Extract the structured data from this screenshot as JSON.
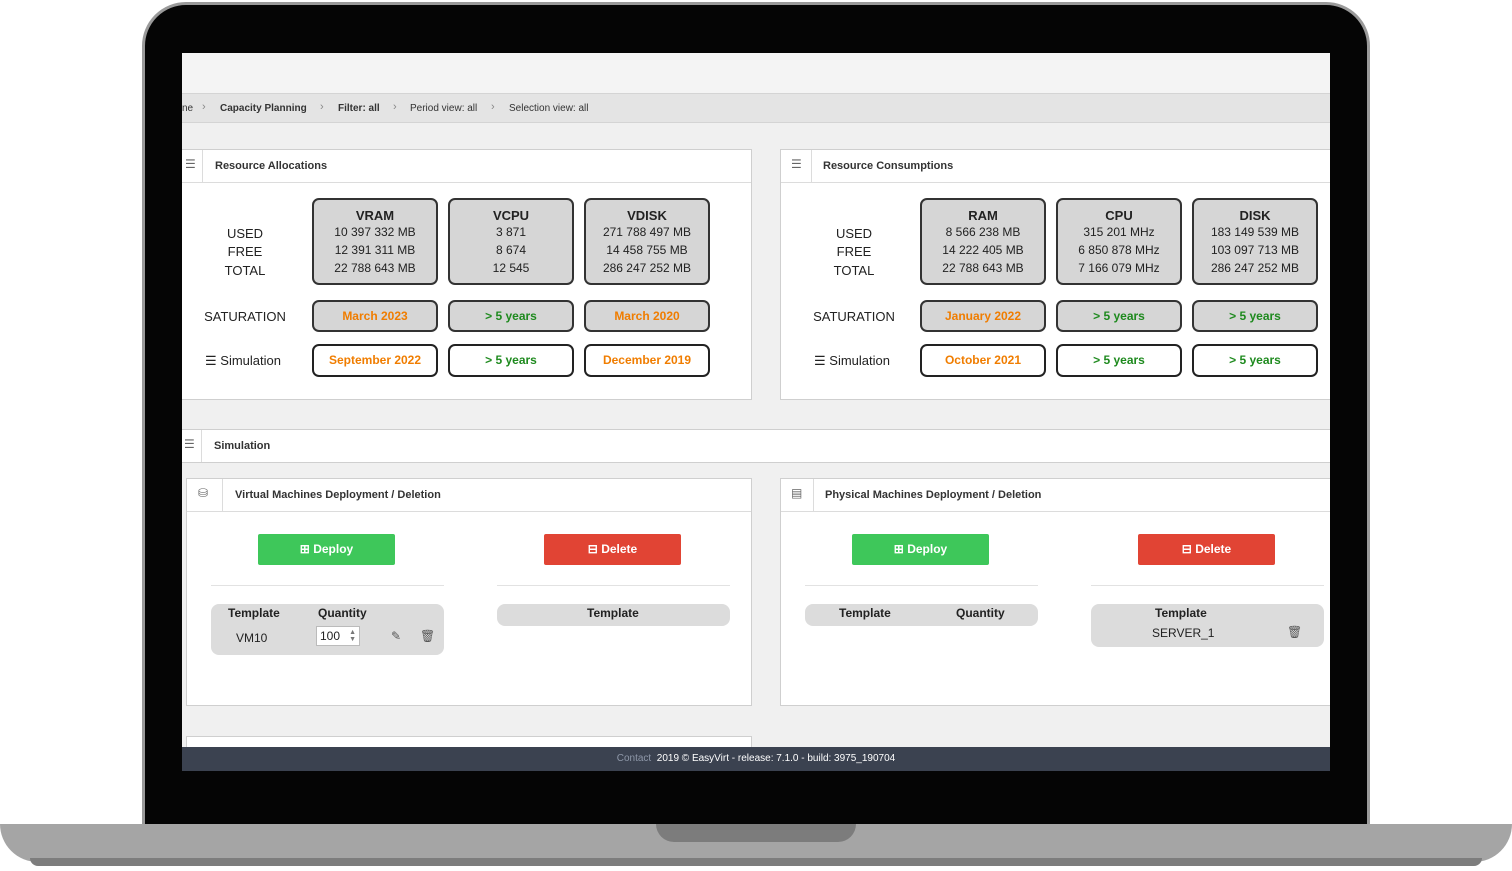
{
  "breadcrumb": {
    "home": "ne",
    "items": [
      "Capacity Planning",
      "Filter: all",
      "Period view: all",
      "Selection view: all"
    ]
  },
  "allocations": {
    "title": "Resource Allocations",
    "labels": {
      "used": "USED",
      "free": "FREE",
      "total": "TOTAL",
      "saturation": "SATURATION",
      "simulation": "Simulation"
    },
    "columns": [
      {
        "name": "VRAM",
        "used": "10 397 332 MB",
        "free": "12 391 311 MB",
        "total": "22 788 643 MB",
        "saturation": "March 2023",
        "simulation": "September 2022"
      },
      {
        "name": "VCPU",
        "used": "3 871",
        "free": "8 674",
        "total": "12 545",
        "saturation": "> 5 years",
        "simulation": "> 5 years"
      },
      {
        "name": "VDISK",
        "used": "271 788 497 MB",
        "free": "14 458 755 MB",
        "total": "286 247 252 MB",
        "saturation": "March 2020",
        "simulation": "December 2019"
      }
    ]
  },
  "consumptions": {
    "title": "Resource Consumptions",
    "labels": {
      "used": "USED",
      "free": "FREE",
      "total": "TOTAL",
      "saturation": "SATURATION",
      "simulation": "Simulation"
    },
    "columns": [
      {
        "name": "RAM",
        "used": "8 566 238 MB",
        "free": "14 222 405 MB",
        "total": "22 788 643 MB",
        "saturation": "January 2022",
        "simulation": "October 2021"
      },
      {
        "name": "CPU",
        "used": "315 201 MHz",
        "free": "6 850 878 MHz",
        "total": "7 166 079 MHz",
        "saturation": "> 5 years",
        "simulation": "> 5 years"
      },
      {
        "name": "DISK",
        "used": "183 149 539 MB",
        "free": "103 097 713 MB",
        "total": "286 247 252 MB",
        "saturation": "> 5 years",
        "simulation": "> 5 years"
      }
    ]
  },
  "simulation": {
    "title": "Simulation",
    "vm": {
      "title": "Virtual Machines Deployment / Deletion",
      "deploy_label": "Deploy",
      "delete_label": "Delete",
      "deploy_table": {
        "col_template": "Template",
        "col_quantity": "Quantity",
        "template": "VM10",
        "quantity": "100"
      },
      "delete_table": {
        "col_template": "Template"
      }
    },
    "pm": {
      "title": "Physical Machines Deployment / Deletion",
      "deploy_label": "Deploy",
      "delete_label": "Delete",
      "deploy_table": {
        "col_template": "Template",
        "col_quantity": "Quantity"
      },
      "delete_table": {
        "col_template": "Template",
        "template": "SERVER_1"
      }
    }
  },
  "footer": {
    "contact": "Contact",
    "text": "2019 © EasyVirt - release: 7.1.0 - build: 3975_190704"
  },
  "colors": {
    "orange": "#f07d00",
    "green": "#1e8a1e",
    "deploy": "#3ec75a",
    "delete": "#e14434"
  }
}
